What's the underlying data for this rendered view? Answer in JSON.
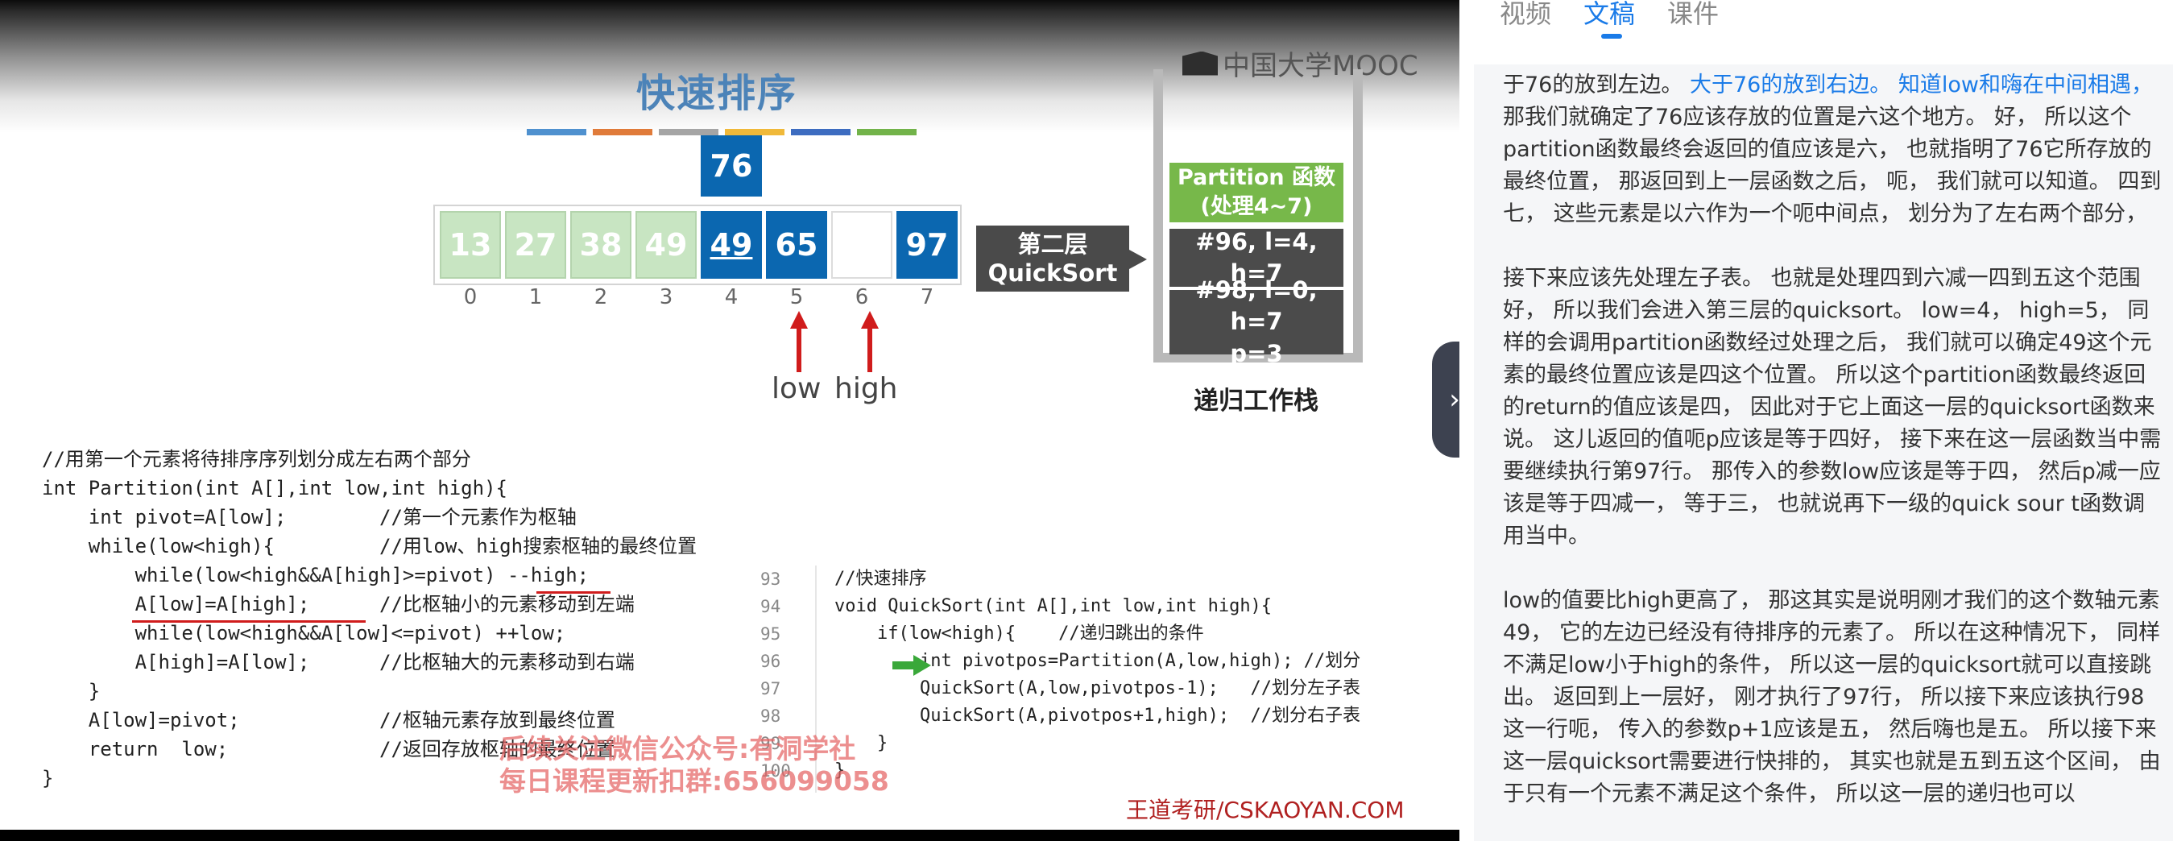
{
  "slide": {
    "title": "快速排序",
    "brand_logo": "中国大学MOOC",
    "color_strip": [
      "#4f91cf",
      "#e07b3a",
      "#a5a5a5",
      "#f0b93a",
      "#3d6cc0",
      "#72b34a"
    ],
    "pivot_value": "76",
    "array": [
      {
        "value": "13",
        "state": "light"
      },
      {
        "value": "27",
        "state": "light"
      },
      {
        "value": "38",
        "state": "light"
      },
      {
        "value": "49",
        "state": "light"
      },
      {
        "value": "49",
        "state": "blue-underlined"
      },
      {
        "value": "65",
        "state": "blue"
      },
      {
        "value": "",
        "state": "empty"
      },
      {
        "value": "97",
        "state": "blue"
      }
    ],
    "indices": [
      "0",
      "1",
      "2",
      "3",
      "4",
      "5",
      "6",
      "7"
    ],
    "pointers": {
      "low": "low",
      "high": "high"
    },
    "layer_tag": {
      "line1": "第二层",
      "line2": "QuickSort"
    },
    "stack": {
      "label": "递归工作栈",
      "frames": [
        {
          "line1": "Partition 函数",
          "line2": "(处理4~7)"
        },
        {
          "line1": "#96, l=4, h=7",
          "line2": ""
        },
        {
          "line1": "#98, l=0, h=7",
          "line2": "p=3"
        }
      ]
    },
    "code_left": [
      "//用第一个元素将待排序序列划分成左右两个部分",
      "int Partition(int A[],int low,int high){",
      "    int pivot=A[low];        //第一个元素作为枢轴",
      "    while(low<high){         //用low、high搜索枢轴的最终位置",
      "        while(low<high&&A[high]>=pivot) --high;",
      "        A[low]=A[high];      //比枢轴小的元素移动到左端",
      "        while(low<high&&A[low]<=pivot) ++low;",
      "        A[high]=A[low];      //比枢轴大的元素移动到右端",
      "    }",
      "    A[low]=pivot;            //枢轴元素存放到最终位置",
      "    return  low;             //返回存放枢轴的最终位置",
      "}"
    ],
    "code_right_lines": [
      "93",
      "94",
      "95",
      "96",
      "97",
      "98",
      "99",
      "100"
    ],
    "code_right": [
      "//快速排序",
      "void QuickSort(int A[],int low,int high){",
      "    if(low<high){    //递归跳出的条件",
      "        int pivotpos=Partition(A,low,high); //划分",
      "        QuickSort(A,low,pivotpos-1);   //划分左子表",
      "        QuickSort(A,pivotpos+1,high);  //划分右子表",
      "    }",
      "}"
    ],
    "watermark": {
      "line1": "后续关注微信公众号:有洞学社",
      "line2": "每日课程更新扣群:656099058"
    },
    "footer_brand": "王道考研/CSKAOYAN.COM"
  },
  "side_toggle_icon": "chevron-right-icon",
  "panel": {
    "tabs": [
      {
        "label": "视频",
        "active": false
      },
      {
        "label": "文稿",
        "active": true
      },
      {
        "label": "课件",
        "active": false
      }
    ],
    "accent_color": "#1a7be8",
    "paragraphs": [
      {
        "pre": "于76的放到左边。 ",
        "highlight": "大于76的放到右边。 知道low和嗨在中间相遇，",
        "post": " 那我们就确定了76应该存放的位置是六这个地方。 好， 所以这个partition函数最终会返回的值应该是六， 也就指明了76它所存放的最终位置， 那返回到上一层函数之后， 呃， 我们就可以知道。 四到七， 这些元素是以六作为一个呃中间点， 划分为了左右两个部分，"
      },
      {
        "pre": "接下来应该先处理左子表。 也就是处理四到六减一四到五这个范围好， 所以我们会进入第三层的quicksort。 low=4， high=5， 同样的会调用partition函数经过处理之后， 我们就可以确定49这个元素的最终位置应该是四这个位置。 所以这个partition函数最终返回的return的值应该是四， 因此对于它上面这一层的quicksort函数来说。 这儿返回的值呃p应该是等于四好， 接下来在这一层函数当中需要继续执行第97行。 那传入的参数low应该是等于四， 然后p减一应该是等于四减一， 等于三， 也就说再下一级的quick sour t函数调用当中。",
        "highlight": "",
        "post": ""
      },
      {
        "pre": "low的值要比high更高了， 那这其实是说明刚才我们的这个数轴元素49， 它的左边已经没有待排序的元素了。 所以在这种情况下， 同样不满足low小于high的条件， 所以这一层的quicksort就可以直接跳出。 返回到上一层好， 刚才执行了97行， 所以接下来应该执行98这一行呃， 传入的参数p+1应该是五， 然后嗨也是五。 所以接下来这一层quicksort需要进行快排的， 其实也就是五到五这个区间， 由于只有一个元素不满足这个条件， 所以这一层的递归也可以",
        "highlight": "",
        "post": ""
      }
    ]
  }
}
